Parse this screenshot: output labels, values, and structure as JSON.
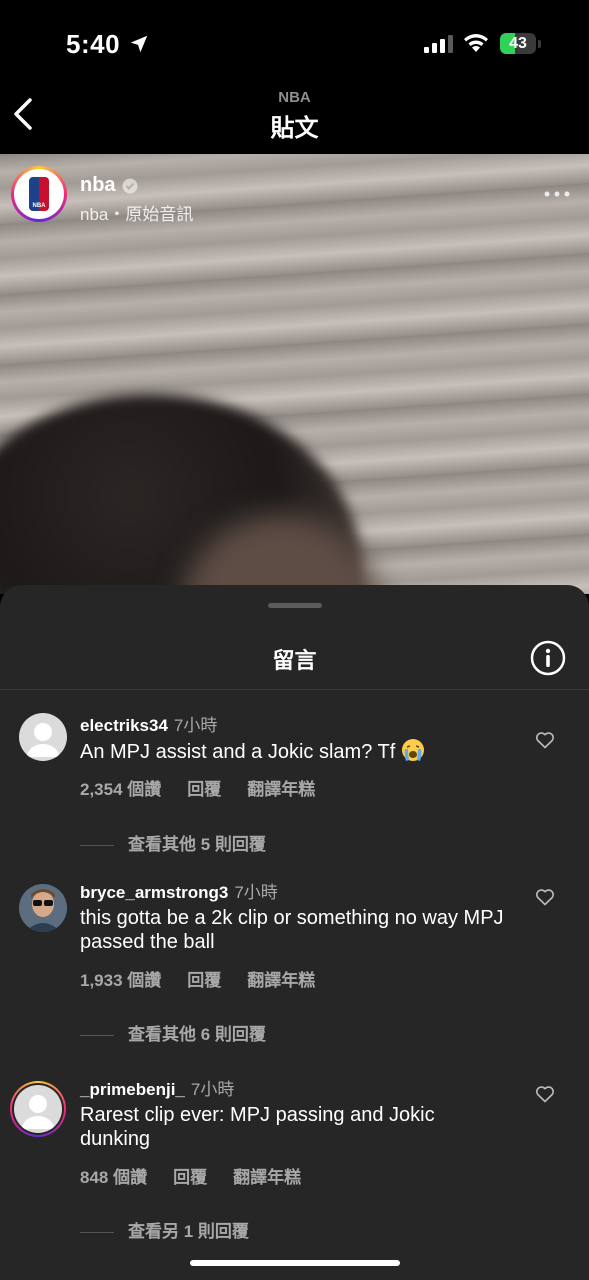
{
  "status_bar": {
    "time": "5:40",
    "battery": "43",
    "battery_level_percent": 43,
    "icons": [
      "location-arrow-icon",
      "signal-icon",
      "wifi-icon",
      "battery-icon"
    ]
  },
  "nav": {
    "subtitle": "NBA",
    "title": "貼文",
    "back_icon": "chevron-left-icon"
  },
  "post": {
    "username": "nba",
    "audio": "nba・原始音訊",
    "logo_text": "NBA",
    "more_icon": "ellipsis-icon",
    "verified_icon": "verified-badge-icon"
  },
  "comments_sheet": {
    "title": "留言",
    "info_icon": "info-icon",
    "comments": [
      {
        "username": "electriks34",
        "time": "7小時",
        "text": "An MPJ assist and a Jokic slam? Tf",
        "emoji": "loudly-crying-face",
        "likes": "2,354 個讚",
        "reply": "回覆",
        "translate": "翻譯年糕",
        "view_replies": "查看其他 5 則回覆"
      },
      {
        "username": "bryce_armstrong3",
        "time": "7小時",
        "text": "this gotta be a 2k clip or something no way MPJ passed the ball",
        "likes": "1,933 個讚",
        "reply": "回覆",
        "translate": "翻譯年糕",
        "view_replies": "查看其他 6 則回覆"
      },
      {
        "username": "_primebenji_",
        "time": "7小時",
        "text": "Rarest clip ever: MPJ passing and Jokic dunking",
        "likes": "848 個讚",
        "reply": "回覆",
        "translate": "翻譯年糕",
        "view_replies": "查看另 1 則回覆"
      }
    ]
  }
}
